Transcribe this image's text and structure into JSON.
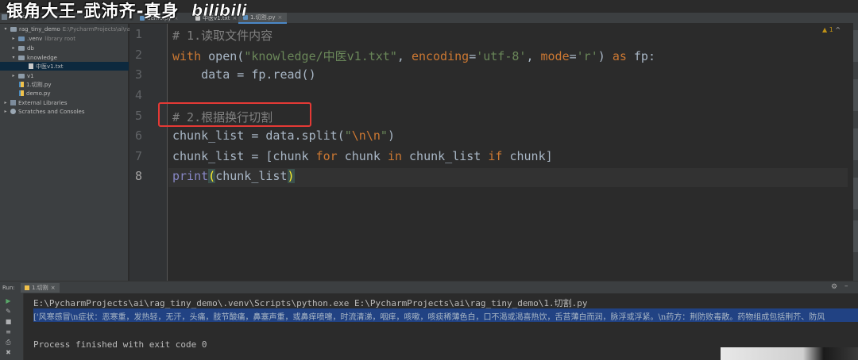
{
  "watermark": {
    "text": "银角大王-武沛齐-真身",
    "logo_text": "bilibili"
  },
  "tabs": {
    "tool_window": "Project",
    "editor": [
      {
        "label": "demo.py",
        "active": false
      },
      {
        "label": "中医v1.txt",
        "active": false
      },
      {
        "label": "1.切割.py",
        "active": true
      }
    ]
  },
  "project_tree": [
    {
      "label": "rag_tiny_demo",
      "hint": "E:\\PycharmProjects\\ai\\rag",
      "depth": 0,
      "kind": "folder",
      "expanded": true,
      "selected": false
    },
    {
      "label": ".venv",
      "hint": "library root",
      "depth": 1,
      "kind": "folder",
      "expanded": false,
      "selected": false
    },
    {
      "label": "db",
      "hint": "",
      "depth": 1,
      "kind": "folder",
      "expanded": false,
      "selected": false
    },
    {
      "label": "knowledge",
      "hint": "",
      "depth": 1,
      "kind": "folder",
      "expanded": true,
      "selected": false
    },
    {
      "label": "中医v1.txt",
      "hint": "",
      "depth": 2,
      "kind": "txt",
      "expanded": null,
      "selected": true
    },
    {
      "label": "v1",
      "hint": "",
      "depth": 1,
      "kind": "folder",
      "expanded": false,
      "selected": false
    },
    {
      "label": "1.切割.py",
      "hint": "",
      "depth": 1,
      "kind": "py",
      "expanded": null,
      "selected": false
    },
    {
      "label": "demo.py",
      "hint": "",
      "depth": 1,
      "kind": "py",
      "expanded": null,
      "selected": false
    },
    {
      "label": "External Libraries",
      "hint": "",
      "depth": 0,
      "kind": "lib",
      "expanded": false,
      "selected": false
    },
    {
      "label": "Scratches and Consoles",
      "hint": "",
      "depth": 0,
      "kind": "scratch",
      "expanded": false,
      "selected": false
    }
  ],
  "editor": {
    "line_numbers": [
      "1",
      "2",
      "3",
      "4",
      "5",
      "6",
      "7",
      "8"
    ],
    "inspection": {
      "warnings": "▲ 1",
      "up": "^"
    },
    "lines": [
      [
        {
          "t": "# 1.读取文件内容",
          "c": "cmt"
        }
      ],
      [
        {
          "t": "with",
          "c": "kw"
        },
        {
          "t": " open(",
          "c": ""
        },
        {
          "t": "\"knowledge/中医v1.txt\"",
          "c": "str"
        },
        {
          "t": ", ",
          "c": ""
        },
        {
          "t": "encoding",
          "c": "kw"
        },
        {
          "t": "=",
          "c": ""
        },
        {
          "t": "'utf-8'",
          "c": "str"
        },
        {
          "t": ", ",
          "c": ""
        },
        {
          "t": "mode",
          "c": "kw"
        },
        {
          "t": "=",
          "c": ""
        },
        {
          "t": "'r'",
          "c": "str"
        },
        {
          "t": ") ",
          "c": ""
        },
        {
          "t": "as",
          "c": "kw"
        },
        {
          "t": " fp:",
          "c": ""
        }
      ],
      [
        {
          "t": "    data = fp.read()",
          "c": ""
        }
      ],
      [
        {
          "t": "",
          "c": ""
        }
      ],
      [
        {
          "t": "# 2.根据换行切割",
          "c": "cmt"
        }
      ],
      [
        {
          "t": "chunk_list = data.split(",
          "c": ""
        },
        {
          "t": "\"",
          "c": "str"
        },
        {
          "t": "\\n\\n",
          "c": "esc"
        },
        {
          "t": "\"",
          "c": "str"
        },
        {
          "t": ")",
          "c": ""
        }
      ],
      [
        {
          "t": "chunk_list = [chunk ",
          "c": ""
        },
        {
          "t": "for",
          "c": "kw"
        },
        {
          "t": " chunk ",
          "c": ""
        },
        {
          "t": "in",
          "c": "kw"
        },
        {
          "t": " chunk_list ",
          "c": ""
        },
        {
          "t": "if",
          "c": "kw"
        },
        {
          "t": " chunk]",
          "c": ""
        }
      ],
      [
        {
          "t": "print",
          "c": "bi"
        },
        {
          "t": "(",
          "c": "paren-hl"
        },
        {
          "t": "chunk_list",
          "c": ""
        },
        {
          "t": ")",
          "c": "paren-hl"
        }
      ]
    ]
  },
  "run_panel": {
    "label": "Run:",
    "tab": "1.切割",
    "command": "E:\\PycharmProjects\\ai\\rag_tiny_demo\\.venv\\Scripts\\python.exe E:\\PycharmProjects\\ai\\rag_tiny_demo\\1.切割.py",
    "output": "['风寒感冒\\n症状：恶寒重，发热轻，无汗，头痛，肢节酸痛，鼻塞声重，或鼻痒喷嚏，时流清涕，咽痒，咳嗽，咳痰稀薄色白，口不渴或渴喜热饮，舌苔薄白而润，脉浮或浮紧。\\n药方：荆防败毒散。药物组成包括荆芥、防风",
    "exit": "Process finished with exit code 0"
  },
  "colors": {
    "accent": "#4a88c7",
    "highlight_box": "#e53935",
    "selection": "#214283"
  }
}
